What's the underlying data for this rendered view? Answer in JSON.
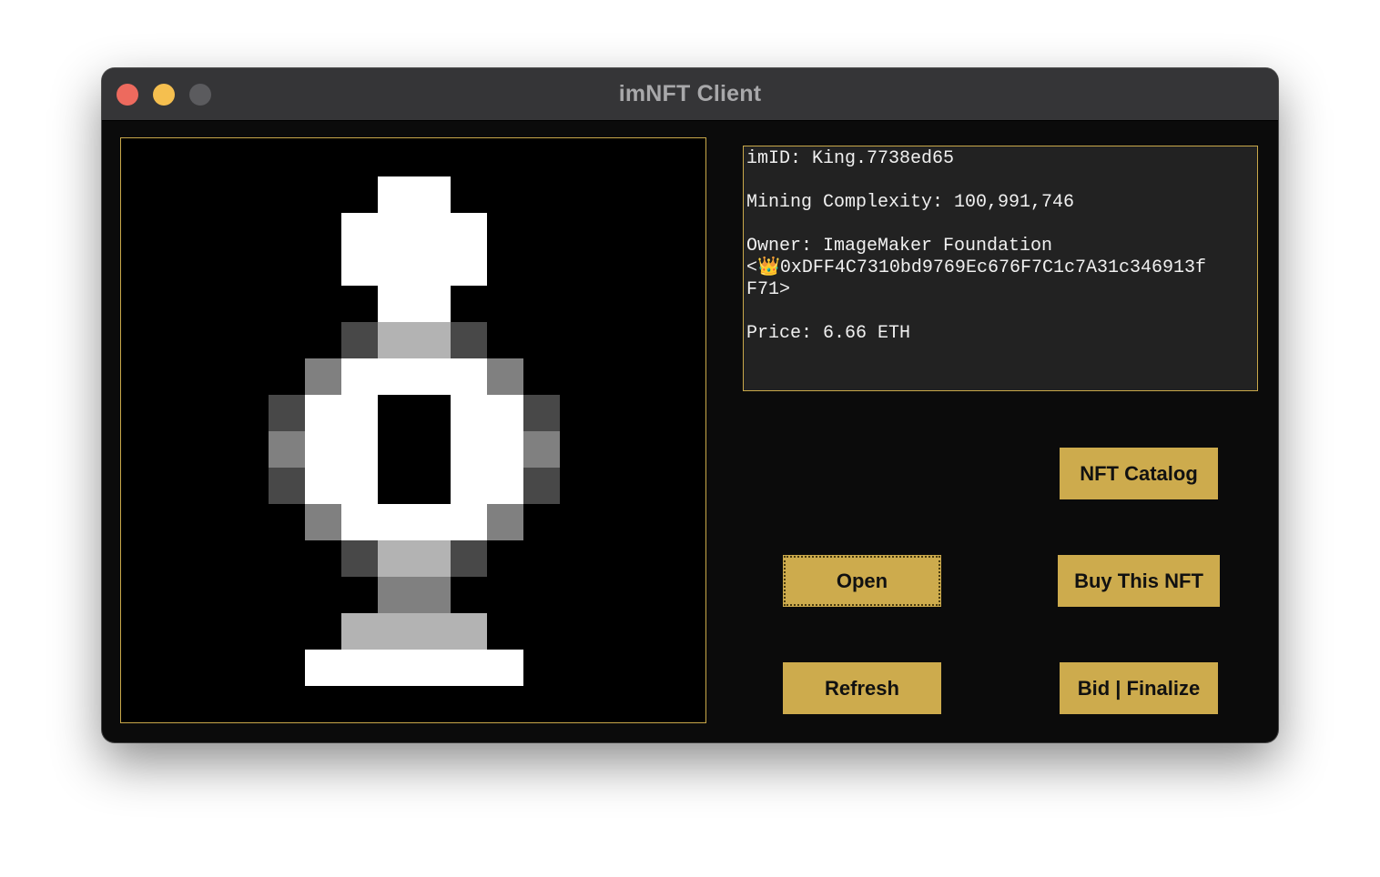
{
  "window": {
    "title": "imNFT Client"
  },
  "info": {
    "imid_line": "imID: King.7738ed65",
    "complexity_line": "Mining Complexity: 100,991,746",
    "owner_line": "Owner: ImageMaker Foundation",
    "address_line1": "<👑0xDFF4C7310bd9769Ec676F7C1c7A31c346913f",
    "address_line2": "F71>",
    "price_line": "Price: 6.66 ETH"
  },
  "buttons": {
    "catalog": "NFT Catalog",
    "open": "Open",
    "buy": "Buy This NFT",
    "refresh": "Refresh",
    "bid": "Bid | Finalize"
  },
  "colors": {
    "accent": "#cdab4d",
    "border": "#c9a84a",
    "window_bg": "#0b0b0b",
    "info_bg": "#222222"
  },
  "image": {
    "subject": "pixel-art king chess piece",
    "palette": [
      "#ffffff",
      "#b3b3b3",
      "#808080",
      "#484848",
      "#000000"
    ]
  }
}
